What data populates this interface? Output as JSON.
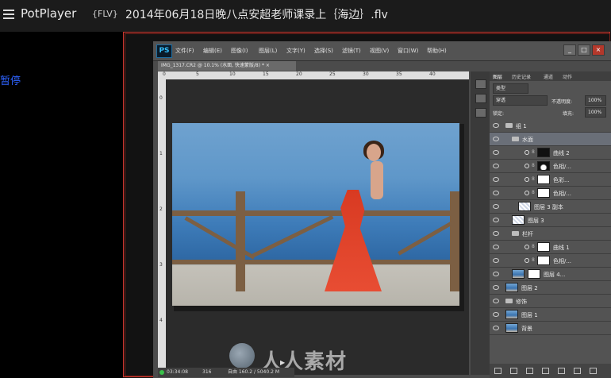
{
  "player": {
    "app_name": "PotPlayer",
    "format": "{FLV}",
    "file_title": "2014年06月18日晚八点安超老师课录上｛海边｝.flv",
    "pause_label": "暂停",
    "accent_border": "#c9352d"
  },
  "photoshop": {
    "logo": "PS",
    "menu": [
      "文件(F)",
      "编辑(E)",
      "图像(I)",
      "图层(L)",
      "文字(Y)",
      "选择(S)",
      "滤镜(T)",
      "视图(V)",
      "窗口(W)",
      "帮助(H)"
    ],
    "window_buttons": [
      "_",
      "□",
      "×"
    ],
    "doc_tab": "IMG_1317.CR2 @ 10.1% (水面, 快速蒙版/8) * ×",
    "status": {
      "time": "03:34:08",
      "ram": "316",
      "zoom": "自由 160.2 / 5040.2 M"
    },
    "watermark_text": "人人素材",
    "ruler_numbers": [
      "0",
      "5",
      "10",
      "15",
      "20",
      "25",
      "30",
      "35",
      "40"
    ],
    "ruler_left_numbers": [
      "0",
      "1",
      "2",
      "3",
      "4"
    ]
  },
  "layers_panel": {
    "tabs": [
      "图层",
      "历史记录",
      "通道",
      "动作"
    ],
    "filter_label": "类型",
    "blend_mode": "穿透",
    "opacity_label": "不透明度:",
    "opacity_value": "100%",
    "lock_label": "锁定:",
    "fill_label": "填充:",
    "fill_value": "100%",
    "layers": [
      {
        "name": "组 1",
        "kind": "group"
      },
      {
        "name": "水面",
        "kind": "group"
      },
      {
        "name": "曲线 2",
        "kind": "adjust-black"
      },
      {
        "name": "色相/...",
        "kind": "adjust-mask"
      },
      {
        "name": "色彩...",
        "kind": "adjust"
      },
      {
        "name": "色相/...",
        "kind": "adjust"
      },
      {
        "name": "图层 3 副本",
        "kind": "checker"
      },
      {
        "name": "图层 3",
        "kind": "checker"
      },
      {
        "name": "栏杆",
        "kind": "group"
      },
      {
        "name": "曲线 1",
        "kind": "adjust"
      },
      {
        "name": "色相/...",
        "kind": "adjust"
      },
      {
        "name": "图层 4...",
        "kind": "photo-mask"
      },
      {
        "name": "图层 2",
        "kind": "photo"
      },
      {
        "name": "修饰",
        "kind": "group"
      },
      {
        "name": "图层 1",
        "kind": "photo"
      },
      {
        "name": "背景",
        "kind": "photo-locked"
      }
    ]
  }
}
